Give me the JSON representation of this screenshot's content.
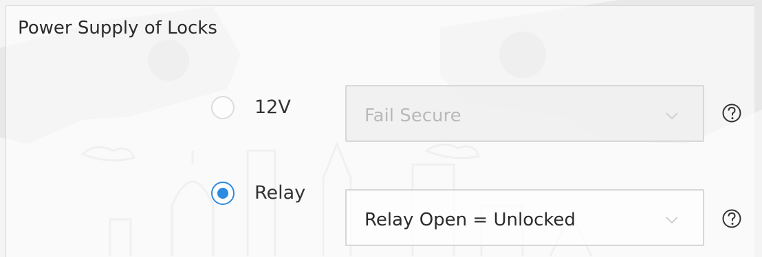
{
  "section": {
    "title": "Power Supply of Locks"
  },
  "options": [
    {
      "label": "12V",
      "selected": false,
      "dropdown": {
        "value": "Fail Secure",
        "disabled": true,
        "icon": "chevron-down-icon"
      },
      "help_icon": "question-mark-circle-icon"
    },
    {
      "label": "Relay",
      "selected": true,
      "dropdown": {
        "value": "Relay Open = Unlocked",
        "disabled": false,
        "icon": "chevron-down-icon"
      },
      "help_icon": "question-mark-circle-icon"
    }
  ],
  "colors": {
    "accent": "#2a8be0",
    "text": "#2b2b2b",
    "disabled_text": "#b9b9b9",
    "border": "#d6d6d6"
  }
}
